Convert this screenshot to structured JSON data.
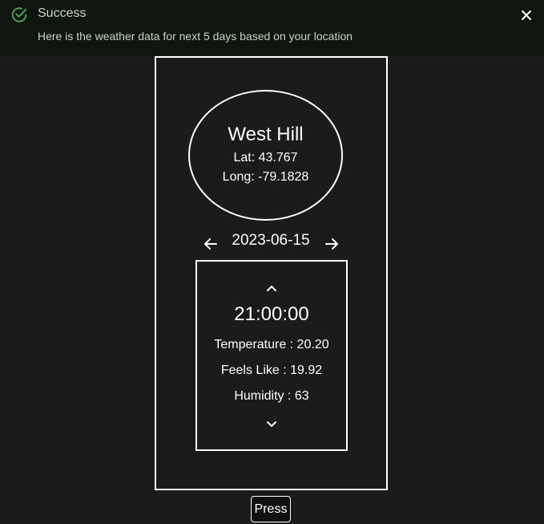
{
  "notification": {
    "title": "Success",
    "message": "Here is the weather data for next 5 days based on your location",
    "status_icon": "check-circle-icon",
    "close_icon": "close-icon",
    "accent_color": "#4caf50",
    "text_color": "#c9d6c2"
  },
  "location": {
    "name": "West Hill",
    "lat": "Lat: 43.767",
    "long": "Long: -79.1828"
  },
  "date_nav": {
    "date": "2023-06-15",
    "prev_icon": "arrow-left-icon",
    "next_icon": "arrow-right-icon"
  },
  "forecast": {
    "time": "21:00:00",
    "temperature": "Temperature : 20.20",
    "feels_like": "Feels Like : 19.92",
    "humidity": "Humidity : 63",
    "up_icon": "chevron-up-icon",
    "down_icon": "chevron-down-icon"
  },
  "press_button": {
    "label": "Press"
  },
  "colors": {
    "background": "#1b1b1b",
    "notification_background": "#0f150f",
    "foreground": "#ffffff"
  }
}
